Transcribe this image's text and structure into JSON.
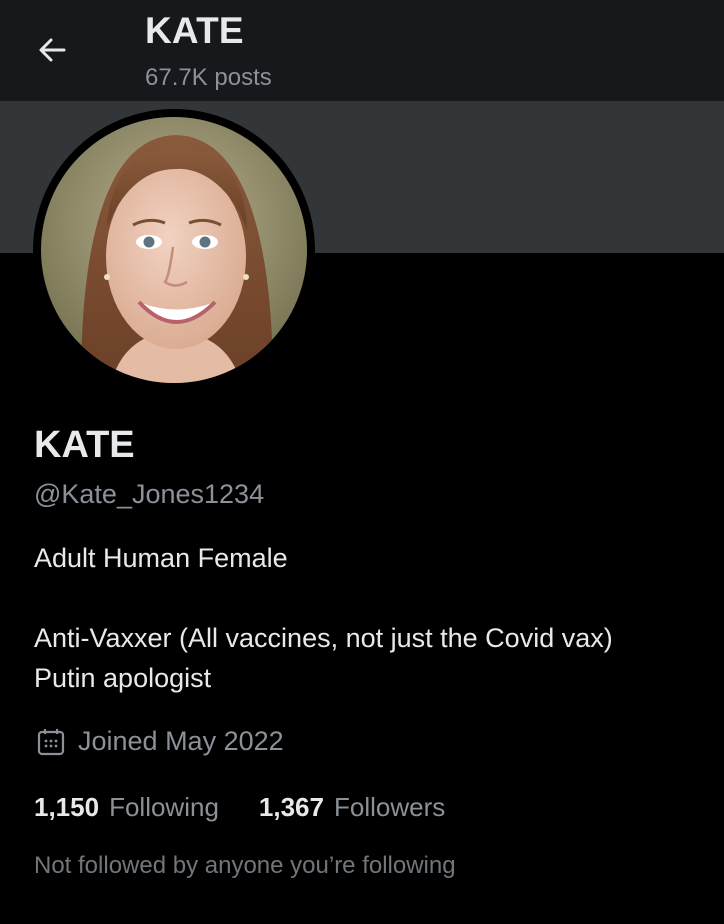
{
  "header": {
    "title": "KATE",
    "post_count": "67.7K posts"
  },
  "profile": {
    "display_name": "KATE",
    "handle": "@Kate_Jones1234",
    "bio_lines": [
      "Adult Human Female",
      "Anti-Vaxxer (All vaccines, not just the Covid vax)",
      "Putin apologist"
    ],
    "joined": "Joined May 2022",
    "following_count": "1,150",
    "following_label": "Following",
    "followers_count": "1,367",
    "followers_label": "Followers",
    "mutuals_note": "Not followed by anyone you’re following"
  },
  "icons": {
    "back": "arrow-left-icon",
    "joined": "calendar-icon"
  },
  "colors": {
    "background": "#000000",
    "header_bg": "#16181c",
    "banner_bg": "#333639",
    "primary_text": "#e7e9ea",
    "secondary_text": "#8b9199"
  }
}
